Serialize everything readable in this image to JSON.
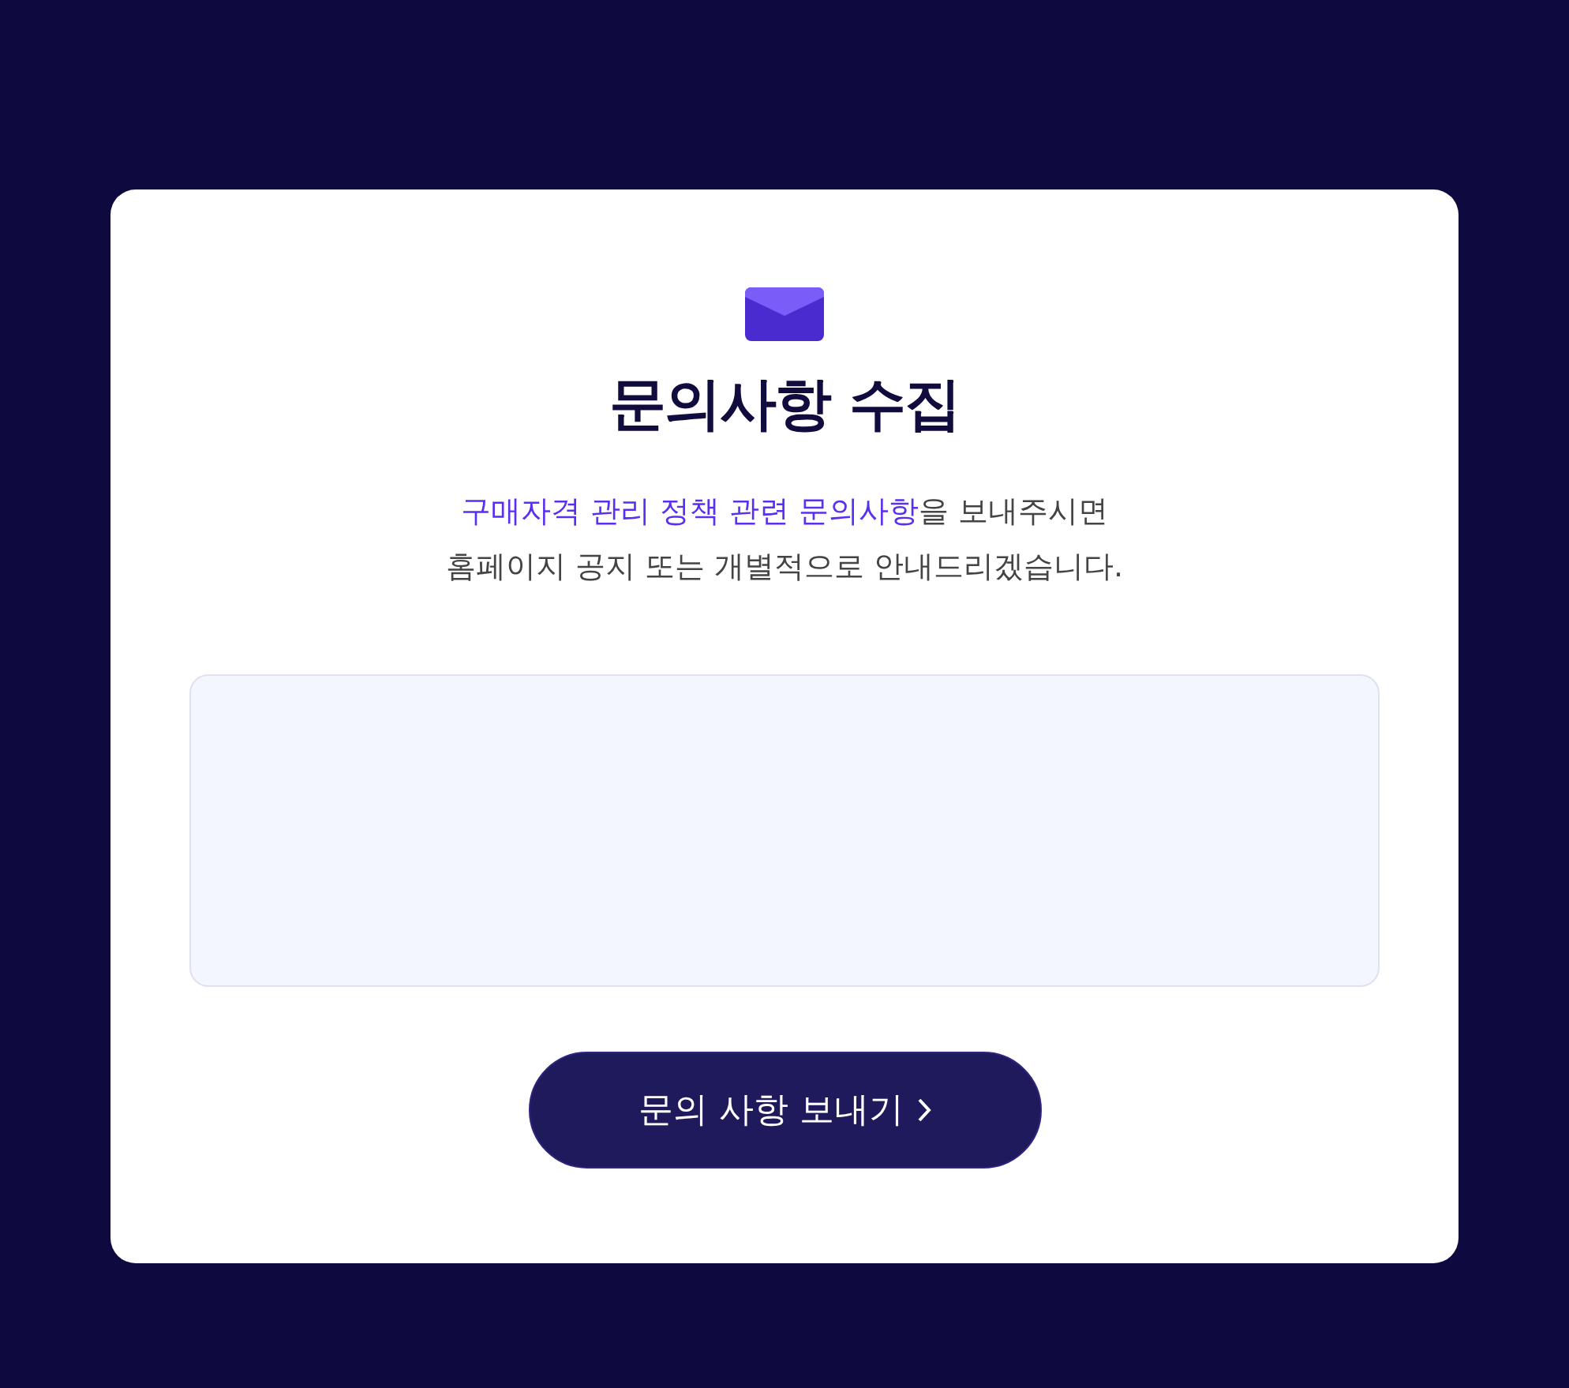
{
  "title": "문의사항 수집",
  "description": [
    [
      {
        "text": "구매자격 관리 정책 관련 문의사항",
        "highlight": true
      },
      {
        "text": "을 보내주시면",
        "highlight": false
      }
    ],
    [
      {
        "text": "홈페이지 공지 또는 개별적으로 안내드리겠습니다.",
        "highlight": false
      }
    ]
  ],
  "submit_button": {
    "label": "문의 사항 보내기"
  }
}
